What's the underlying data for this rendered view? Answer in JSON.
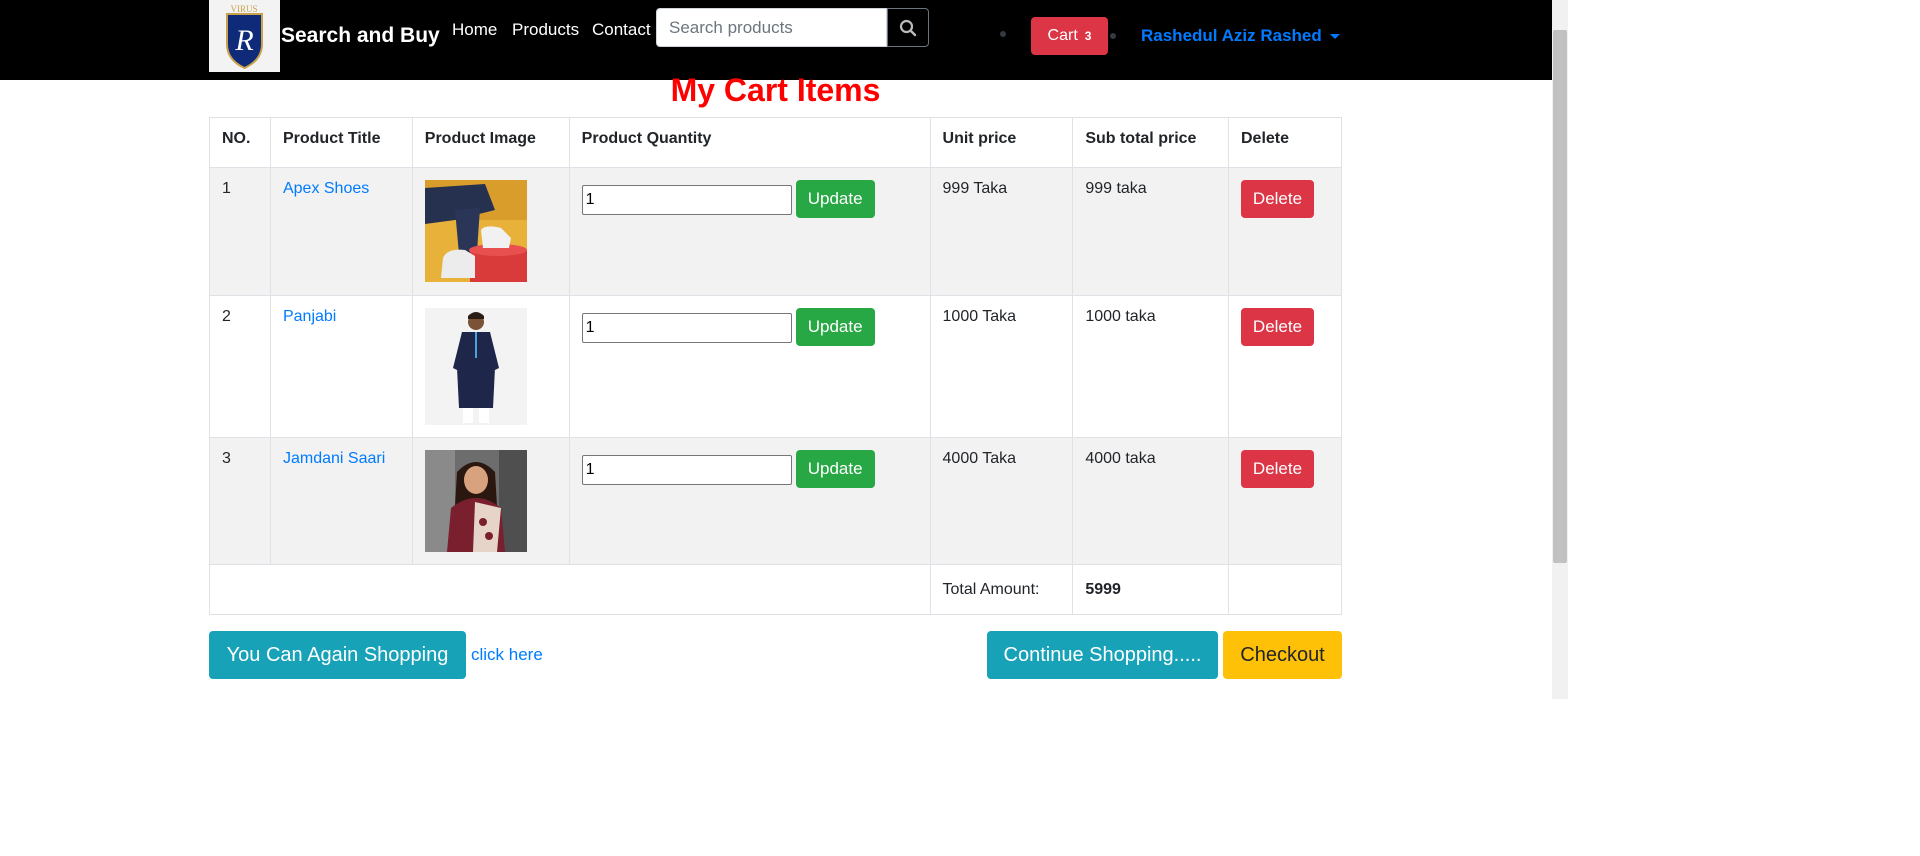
{
  "navbar": {
    "brand": "Search and Buy",
    "logo_text": "VIRUS",
    "logo_letter": "R",
    "links": [
      "Home",
      "Products",
      "Contact"
    ],
    "search_placeholder": "Search products",
    "cart_label": "Cart",
    "cart_count": "3",
    "user_name": "Rashedul Aziz Rashed"
  },
  "page_title": "My Cart Items",
  "table": {
    "headers": [
      "NO.",
      "Product Title",
      "Product Image",
      "Product Quantity",
      "Unit price",
      "Sub total price",
      "Delete"
    ],
    "rows": [
      {
        "no": "1",
        "title": "Apex Shoes",
        "qty": "1",
        "unit": "999 Taka",
        "subtotal": "999 taka"
      },
      {
        "no": "2",
        "title": "Panjabi",
        "qty": "1",
        "unit": "1000 Taka",
        "subtotal": "1000 taka"
      },
      {
        "no": "3",
        "title": "Jamdani Saari",
        "qty": "1",
        "unit": "4000 Taka",
        "subtotal": "4000 taka"
      }
    ],
    "update_label": "Update",
    "delete_label": "Delete",
    "total_label": "Total Amount:",
    "total_value": "5999"
  },
  "actions": {
    "again_label": "You Can Again Shopping",
    "click_here": "click here",
    "continue_label": "Continue Shopping.....",
    "checkout_label": "Checkout"
  },
  "colors": {
    "title": "#ff0000",
    "link": "#007bff",
    "update": "#28a745",
    "delete": "#dc3545",
    "info": "#17a2b8",
    "warning": "#ffc107"
  }
}
